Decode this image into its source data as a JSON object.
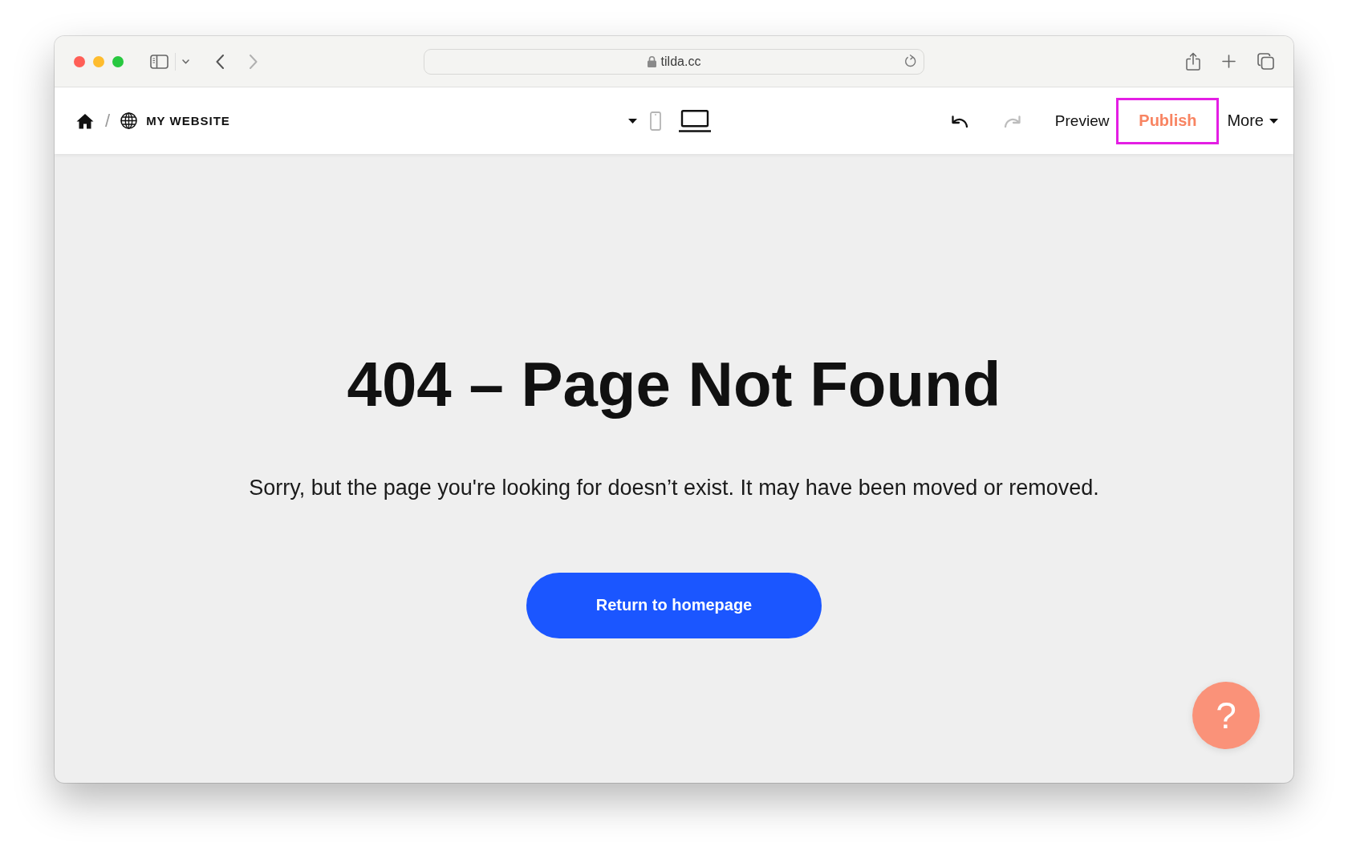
{
  "browser": {
    "window_controls": [
      {
        "color": "#ff5f57"
      },
      {
        "color": "#febc2e"
      },
      {
        "color": "#28c840"
      }
    ],
    "navigation": [
      {
        "kind": "back",
        "disabled": false
      },
      {
        "kind": "forward",
        "disabled": true
      }
    ],
    "url": "tilda.cc"
  },
  "toolbar": {
    "breadcrumb_separator": "/",
    "site_name": "MY WEBSITE",
    "devices": [
      {
        "kind": "phone",
        "selected": false
      },
      {
        "kind": "laptop",
        "selected": true
      }
    ],
    "history": [
      {
        "kind": "undo",
        "disabled": false
      },
      {
        "kind": "redo",
        "disabled": true
      }
    ],
    "preview": "Preview",
    "publish": {
      "label": "Publish",
      "highlighted": true
    },
    "more": "More"
  },
  "content": {
    "title": "404 – Page Not Found",
    "message": "Sorry, but the page you're looking for doesn’t exist. It may have been moved or removed.",
    "button": "Return to homepage"
  },
  "help_button": {
    "label": "?"
  }
}
